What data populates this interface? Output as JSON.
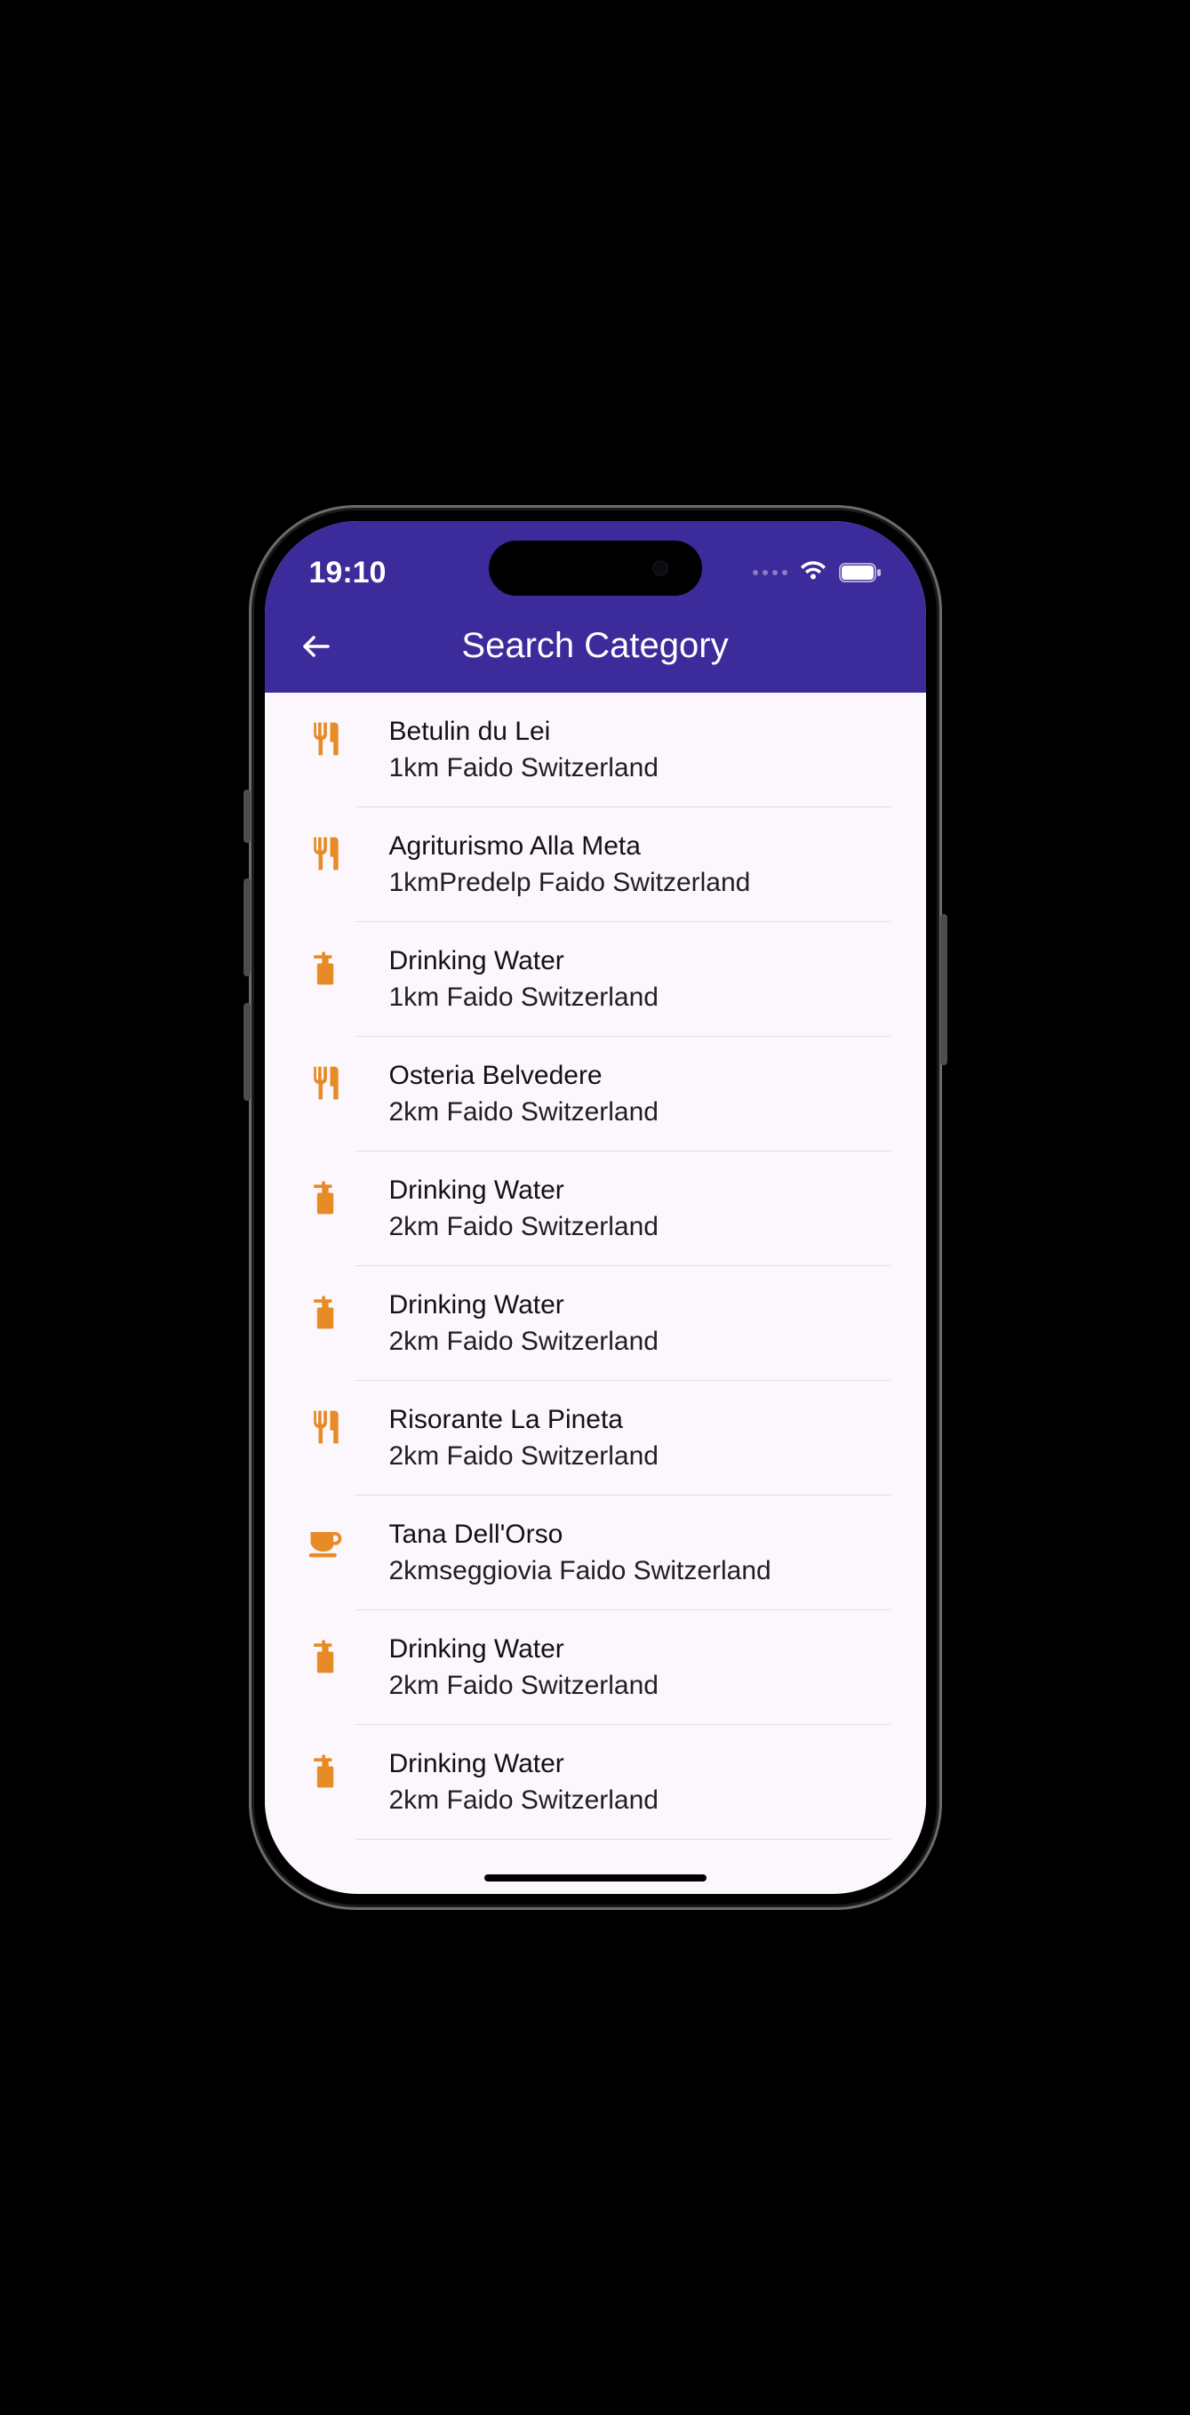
{
  "status": {
    "time": "19:10"
  },
  "nav": {
    "title": "Search Category"
  },
  "colors": {
    "accent": "#3c2b9a",
    "icon": "#e78b26"
  },
  "results": [
    {
      "icon": "restaurant",
      "title": "Betulin du Lei",
      "subtitle": "1km Faido Switzerland"
    },
    {
      "icon": "restaurant",
      "title": "Agriturismo Alla Meta",
      "subtitle": "1kmPredelp Faido Switzerland"
    },
    {
      "icon": "water",
      "title": "Drinking Water",
      "subtitle": "1km Faido Switzerland"
    },
    {
      "icon": "restaurant",
      "title": "Osteria Belvedere",
      "subtitle": "2km Faido Switzerland"
    },
    {
      "icon": "water",
      "title": "Drinking Water",
      "subtitle": "2km Faido Switzerland"
    },
    {
      "icon": "water",
      "title": "Drinking Water",
      "subtitle": "2km Faido Switzerland"
    },
    {
      "icon": "restaurant",
      "title": "Risorante La Pineta",
      "subtitle": "2km Faido Switzerland"
    },
    {
      "icon": "cafe",
      "title": "Tana Dell'Orso",
      "subtitle": "2kmseggiovia Faido Switzerland"
    },
    {
      "icon": "water",
      "title": "Drinking Water",
      "subtitle": "2km Faido Switzerland"
    },
    {
      "icon": "water",
      "title": "Drinking Water",
      "subtitle": "2km Faido Switzerland"
    }
  ]
}
